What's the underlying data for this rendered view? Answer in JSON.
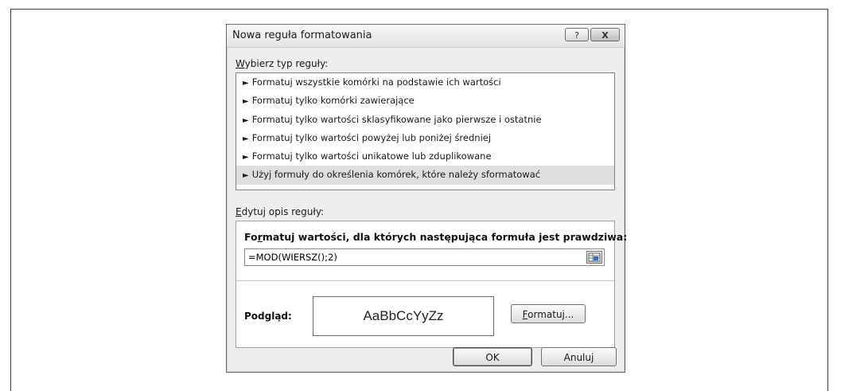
{
  "dialog": {
    "title": "Nowa reguła formatowania",
    "help_label": "?",
    "close_label": "X"
  },
  "rule_type": {
    "label_first": "W",
    "label_rest": "ybierz typ reguły:",
    "items": [
      {
        "label": "Formatuj wszystkie komórki na podstawie ich wartości"
      },
      {
        "label": "Formatuj tylko komórki zawierające"
      },
      {
        "label": "Formatuj tylko wartości sklasyfikowane jako pierwsze i ostatnie"
      },
      {
        "label": "Formatuj tylko wartości powyżej lub poniżej średniej"
      },
      {
        "label": "Formatuj tylko wartości unikatowe lub zduplikowane"
      },
      {
        "label": "Użyj formuły do określenia komórek, które należy sformatować"
      }
    ],
    "selected_index": 5,
    "arrow_glyph": "►"
  },
  "rule_description": {
    "label_first": "E",
    "label_rest": "dytuj opis reguły:",
    "formula_heading_pre": "Fo",
    "formula_heading_u": "r",
    "formula_heading_post": "matuj wartości, dla których następująca formuła jest prawdziwa:",
    "formula_value": "=MOD(WIERSZ();2)",
    "preview_label": "Podgląd:",
    "preview_text": "AaBbCcYyZz",
    "format_button_first": "F",
    "format_button_rest": "ormatuj..."
  },
  "buttons": {
    "ok": "OK",
    "cancel": "Anuluj"
  },
  "icons": {
    "arrow": "triangle-right-icon",
    "range_picker": "range-picker-icon",
    "help": "help-icon",
    "close": "close-icon"
  }
}
